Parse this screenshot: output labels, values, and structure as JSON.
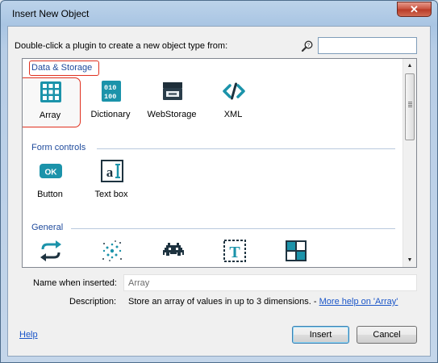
{
  "dialog": {
    "title": "Insert New Object",
    "close_label": "✕"
  },
  "prompt": "Double-click a plugin to create a new object type from:",
  "search": {
    "value": ""
  },
  "categories": [
    {
      "name": "Data & Storage",
      "items": [
        {
          "label": "Array",
          "icon": "array-grid-icon"
        },
        {
          "label": "Dictionary",
          "icon": "dictionary-icon"
        },
        {
          "label": "WebStorage",
          "icon": "webstorage-icon"
        },
        {
          "label": "XML",
          "icon": "xml-icon"
        }
      ]
    },
    {
      "name": "Form controls",
      "items": [
        {
          "label": "Button",
          "icon": "ok-button-icon"
        },
        {
          "label": "Text box",
          "icon": "textbox-icon"
        }
      ]
    },
    {
      "name": "General",
      "items": [
        {
          "label": "",
          "icon": "function-arrows-icon"
        },
        {
          "label": "",
          "icon": "particles-icon"
        },
        {
          "label": "",
          "icon": "sprite-invader-icon"
        },
        {
          "label": "",
          "icon": "text-icon"
        },
        {
          "label": "",
          "icon": "tiled-background-icon"
        }
      ]
    }
  ],
  "selected_item": "Array",
  "fields": {
    "name_label": "Name when inserted:",
    "name_value": "Array",
    "description_label": "Description:",
    "description_text": "Store an array of values in up to 3 dimensions. -",
    "more_help_link": "More help on 'Array'"
  },
  "footer": {
    "help_link": "Help",
    "insert_label": "Insert",
    "cancel_label": "Cancel"
  },
  "colors": {
    "category_header": "#1e4a9c",
    "selection_outline": "#e0301e",
    "icon_teal": "#16a0b4",
    "link": "#1a55c8"
  }
}
